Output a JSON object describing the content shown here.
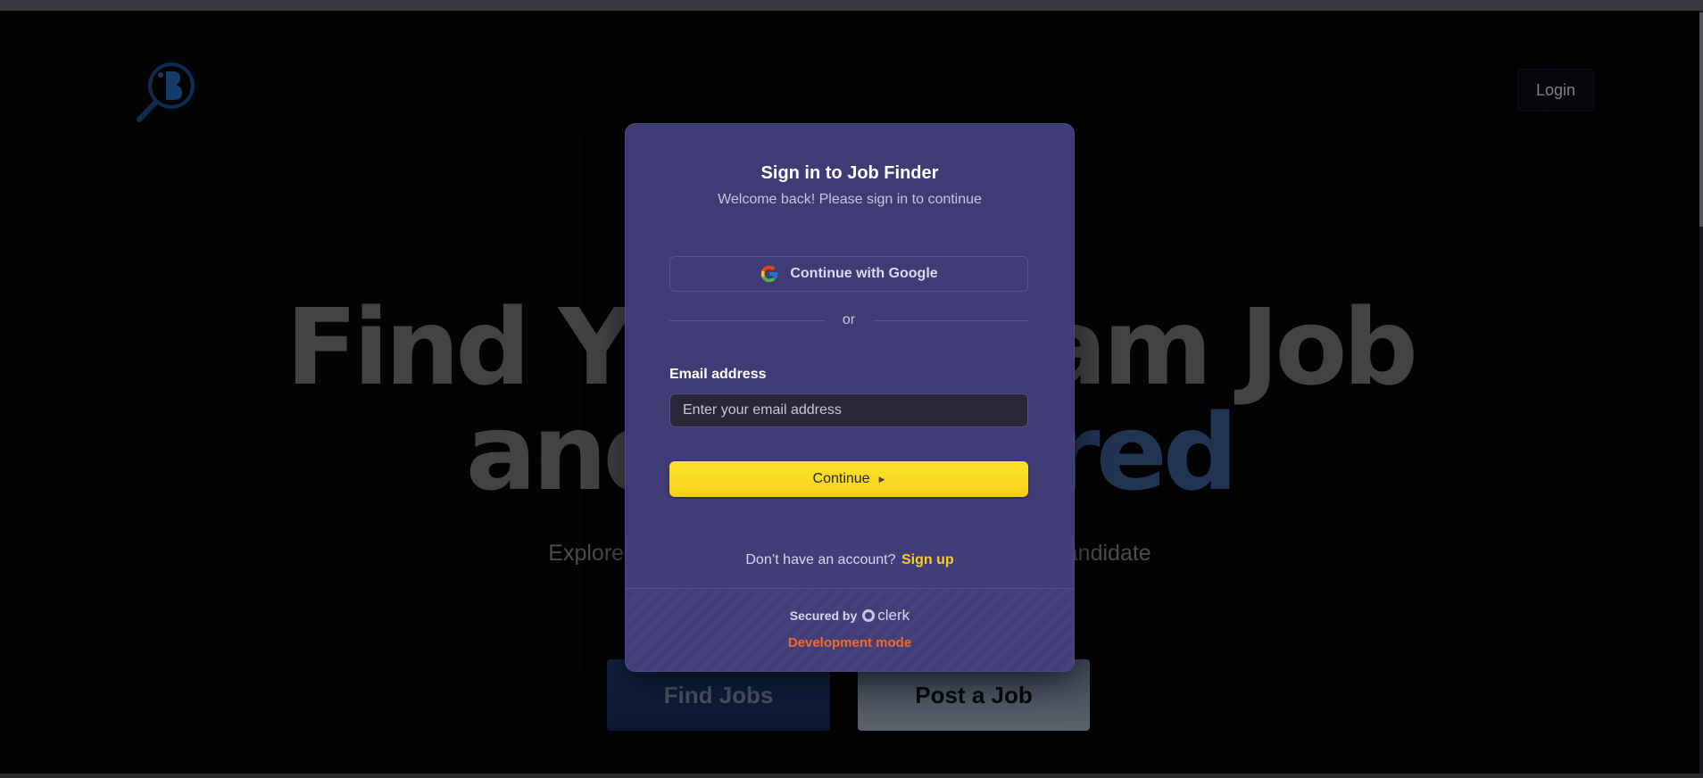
{
  "header": {
    "logo_name": "job-finder-logo",
    "login_label": "Login"
  },
  "hero": {
    "line1": "Find Your Dream Job",
    "line2_prefix": "and Get ",
    "line2_accent": "Hired",
    "subtitle": "Explore thousands of job listings or find the perfect candidate",
    "find_jobs_label": "Find Jobs",
    "post_job_label": "Post a Job"
  },
  "modal": {
    "title": "Sign in to Job Finder",
    "subtitle": "Welcome back! Please sign in to continue",
    "google_label": "Continue with Google",
    "divider_text": "or",
    "email_label": "Email address",
    "email_placeholder": "Enter your email address",
    "email_value": "",
    "continue_label": "Continue",
    "signup_prompt": "Don’t have an account?",
    "signup_link": "Sign up",
    "secured_by": "Secured by",
    "clerk_brand": "clerk",
    "dev_mode": "Development mode"
  },
  "colors": {
    "modal_bg": "#3f3b74",
    "accent_yellow": "#f5cf1c",
    "dev_orange": "#f36b25",
    "hero_accent": "#3c5f9a"
  }
}
